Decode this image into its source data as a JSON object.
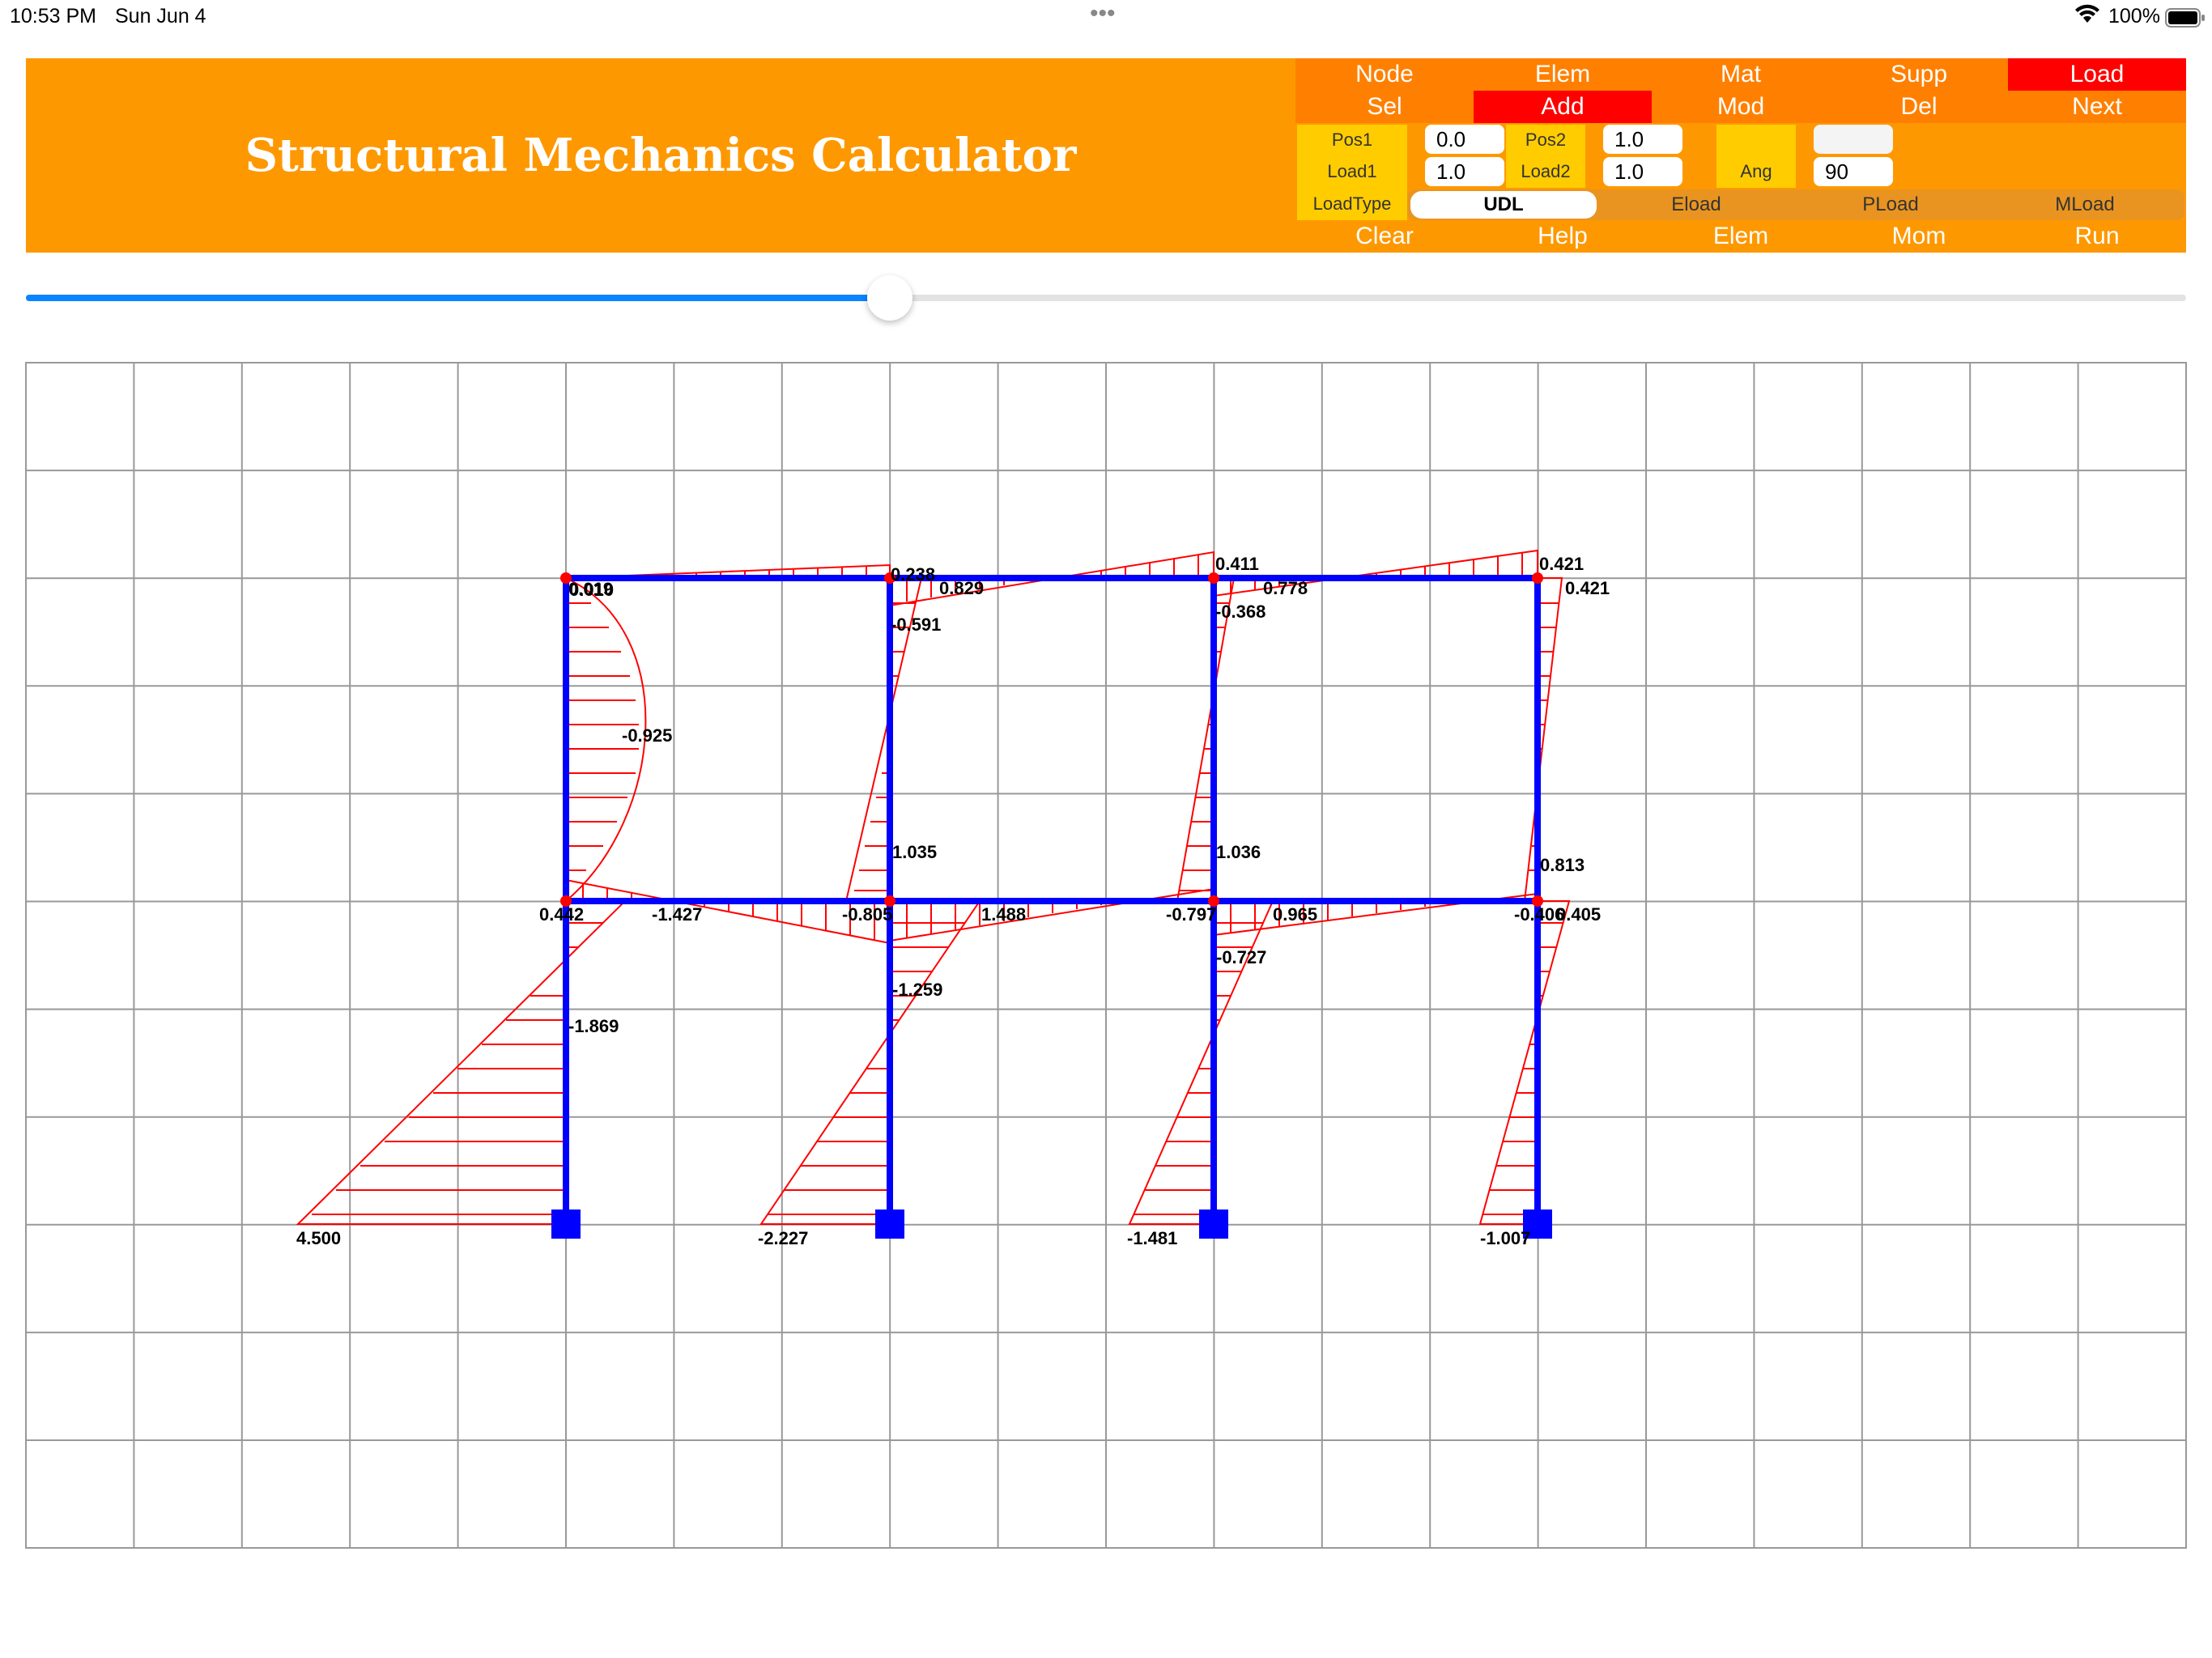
{
  "status_bar": {
    "time": "10:53 PM",
    "date": "Sun Jun 4",
    "battery": "100%",
    "dots": "•••"
  },
  "app": {
    "title": "Structural Mechanics Calculator"
  },
  "toolbar": {
    "row1": [
      {
        "label": "Node",
        "active": false
      },
      {
        "label": "Elem",
        "active": false
      },
      {
        "label": "Mat",
        "active": false
      },
      {
        "label": "Supp",
        "active": false
      },
      {
        "label": "Load",
        "active": true
      }
    ],
    "row2": [
      {
        "label": "Sel",
        "active": false
      },
      {
        "label": "Add",
        "active": true
      },
      {
        "label": "Mod",
        "active": false
      },
      {
        "label": "Del",
        "active": false
      },
      {
        "label": "Next",
        "active": false
      }
    ],
    "row_bottom": [
      {
        "label": "Clear"
      },
      {
        "label": "Help"
      },
      {
        "label": "Elem"
      },
      {
        "label": "Mom"
      },
      {
        "label": "Run"
      }
    ]
  },
  "load_form": {
    "pos1_label": "Pos1",
    "pos1_value": "0.0",
    "pos2_label": "Pos2",
    "pos2_value": "1.0",
    "load1_label": "Load1",
    "load1_value": "1.0",
    "load2_label": "Load2",
    "load2_value": "1.0",
    "ang_label": "Ang",
    "ang_value": "90",
    "extra_value": "",
    "loadtype_label": "LoadType",
    "loadtypes": [
      "UDL",
      "Eload",
      "PLoad",
      "MLoad"
    ],
    "loadtype_selected": "UDL"
  },
  "slider": {
    "value": 0.4
  },
  "colors": {
    "header": "#fe9800",
    "active_button": "#ff0000",
    "nav_bg": "#ff8000",
    "label_bg": "#ffcc00",
    "member": "#0000ff",
    "diagram": "#ff0000",
    "grid": "#999999",
    "slider": "#0a84ff"
  },
  "moment_labels": [
    {
      "id": "m1",
      "text": "0.019"
    },
    {
      "id": "m1b",
      "text": "0.010"
    },
    {
      "id": "m2",
      "text": "0.238"
    },
    {
      "id": "m3",
      "text": "0.829"
    },
    {
      "id": "m4",
      "text": "0.411"
    },
    {
      "id": "m5",
      "text": "0.778"
    },
    {
      "id": "m6",
      "text": "0.421"
    },
    {
      "id": "m7",
      "text": "0.421"
    },
    {
      "id": "m8",
      "text": "-0.591"
    },
    {
      "id": "m9",
      "text": "-0.368"
    },
    {
      "id": "m10",
      "text": "-0.925"
    },
    {
      "id": "m11",
      "text": "1.035"
    },
    {
      "id": "m12",
      "text": "1.036"
    },
    {
      "id": "m13",
      "text": "0.813"
    },
    {
      "id": "m14",
      "text": "0.442"
    },
    {
      "id": "m15",
      "text": "-1.427"
    },
    {
      "id": "m16",
      "text": "-0.805"
    },
    {
      "id": "m17",
      "text": "1.488"
    },
    {
      "id": "m18",
      "text": "-0.797"
    },
    {
      "id": "m19",
      "text": "0.965"
    },
    {
      "id": "m20",
      "text": "-0.406"
    },
    {
      "id": "m21",
      "text": "0.405"
    },
    {
      "id": "m22",
      "text": "-0.727"
    },
    {
      "id": "m23",
      "text": "-1.259"
    },
    {
      "id": "m24",
      "text": "-1.869"
    },
    {
      "id": "m25",
      "text": "4.500"
    },
    {
      "id": "m26",
      "text": "-2.227"
    },
    {
      "id": "m27",
      "text": "-1.481"
    },
    {
      "id": "m28",
      "text": "-1.007"
    }
  ]
}
